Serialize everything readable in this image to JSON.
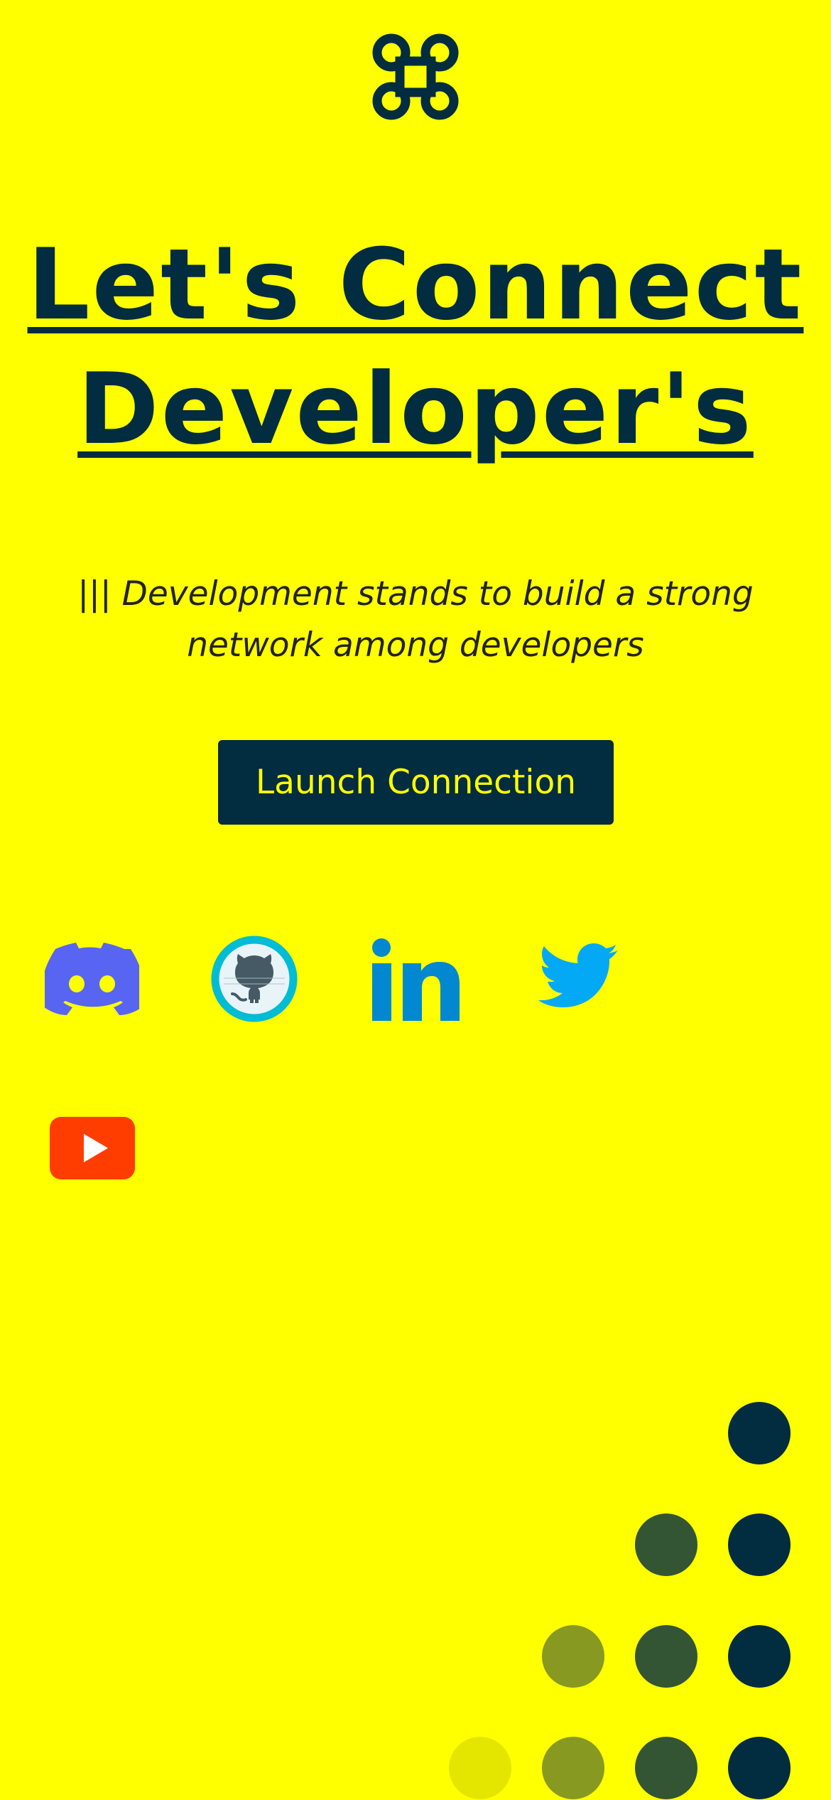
{
  "logo": {
    "icon": "command-icon",
    "color": "#022C3F"
  },
  "hero": {
    "title_line1": "Let's Connect",
    "title_line2": "Developer's",
    "subtitle": "||| Development stands to build a strong network among developers"
  },
  "cta": {
    "label": "Launch Connection"
  },
  "social_links": [
    {
      "name": "Discord",
      "icon": "discord-icon",
      "color": "#5865F2"
    },
    {
      "name": "GitHub",
      "icon": "github-icon",
      "color": "#00BCD4"
    },
    {
      "name": "LinkedIn",
      "icon": "linkedin-icon",
      "color": "#0288D1"
    },
    {
      "name": "Twitter",
      "icon": "twitter-icon",
      "color": "#03A9F4"
    },
    {
      "name": "YouTube",
      "icon": "youtube-icon",
      "color": "#FF3D00"
    }
  ],
  "colors": {
    "background": "#FFFF00",
    "primary": "#022C3F",
    "accent": "#FFFF00"
  },
  "decoration": {
    "dot_colors": [
      "#022C3F",
      "#335533",
      "#889922",
      "#E5E600"
    ]
  }
}
